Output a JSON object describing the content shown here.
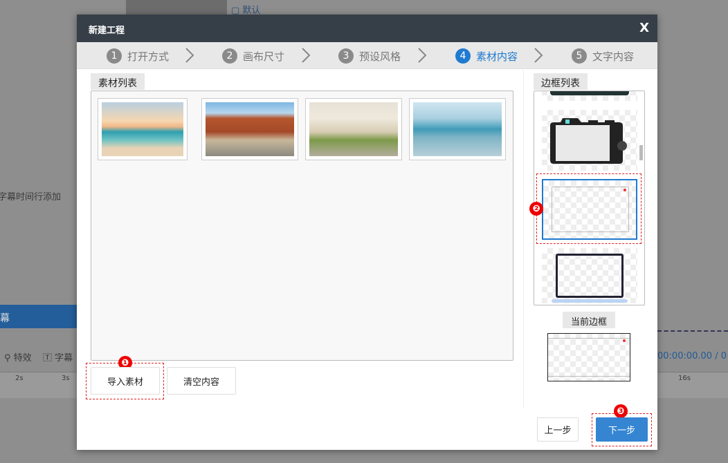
{
  "background": {
    "default_label": "默认",
    "hint_text": "从字幕时间行添加",
    "subtitle_tab": "幕",
    "effects_label": "特效",
    "subtitle_label": "字幕",
    "time_display": "00:00:00.00 / 0",
    "ticks": [
      "2s",
      "3s",
      "16s"
    ]
  },
  "dialog": {
    "title": "新建工程",
    "close": "X",
    "steps": [
      {
        "num": "1",
        "label": "打开方式"
      },
      {
        "num": "2",
        "label": "画布尺寸"
      },
      {
        "num": "3",
        "label": "预设风格"
      },
      {
        "num": "4",
        "label": "素材内容",
        "active": true
      },
      {
        "num": "5",
        "label": "文字内容"
      }
    ],
    "material_list_label": "素材列表",
    "materials": [
      "beach-sunset",
      "desert-road-van",
      "palace-walkway",
      "beach-books"
    ],
    "import_button": "导入素材",
    "clear_button": "清空内容",
    "frame_list_label": "边框列表",
    "frames": [
      "dark-frame",
      "camera-frame",
      "browser-frame",
      "laptop-frame"
    ],
    "selected_frame": "browser-frame",
    "current_frame_label": "当前边框",
    "prev_button": "上一步",
    "next_button": "下一步",
    "badges": [
      "❶",
      "❷",
      "❸"
    ],
    "accent_color": "#1f7ad0",
    "header_color": "#363f48"
  }
}
